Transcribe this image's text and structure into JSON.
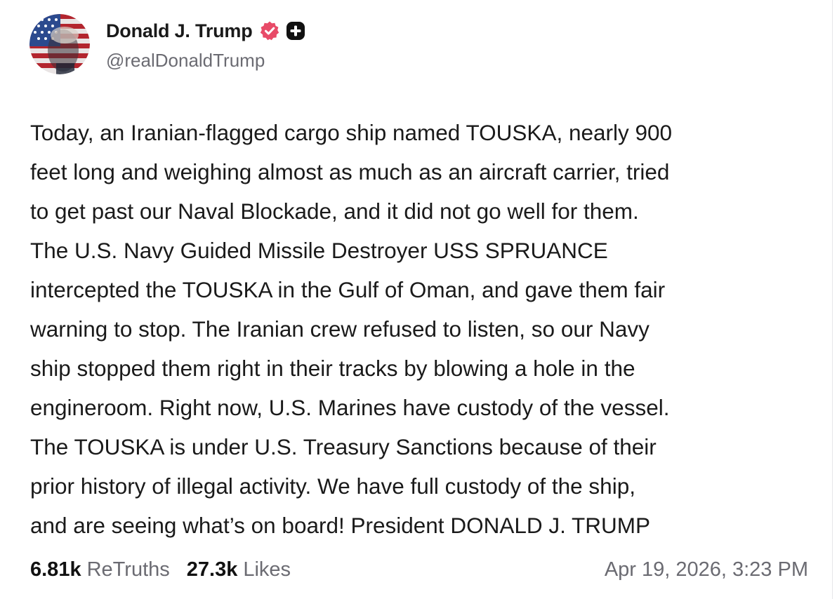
{
  "author": {
    "name": "Donald J. Trump",
    "handle": "@realDonaldTrump",
    "verified_icon": "verified-badge-icon",
    "plus_icon": "plus-badge-icon",
    "verified_color": "#e84b68",
    "plus_badge_color": "#111111"
  },
  "post": {
    "lines": [
      "Today, an Iranian-flagged cargo ship named TOUSKA, nearly 900",
      "feet long and weighing almost as much as an aircraft carrier, tried",
      "to get past our Naval Blockade, and it did not go well for them.",
      "The U.S. Navy Guided Missile Destroyer USS SPRUANCE",
      "intercepted the TOUSKA in the Gulf of Oman, and gave them fair",
      "warning to stop. The Iranian crew refused to listen, so our Navy",
      "ship stopped them right in their tracks by blowing a hole in the",
      "engineroom. Right now, U.S. Marines have custody of the vessel.",
      "The TOUSKA is under U.S. Treasury Sanctions because of their",
      "prior history of illegal activity. We have full custody of the ship,",
      "and are seeing what’s on board! President DONALD J. TRUMP"
    ]
  },
  "stats": {
    "retruths_count": "6.81k",
    "retruths_label": "ReTruths",
    "likes_count": "27.3k",
    "likes_label": "Likes"
  },
  "timestamp": "Apr 19, 2026, 3:23 PM"
}
